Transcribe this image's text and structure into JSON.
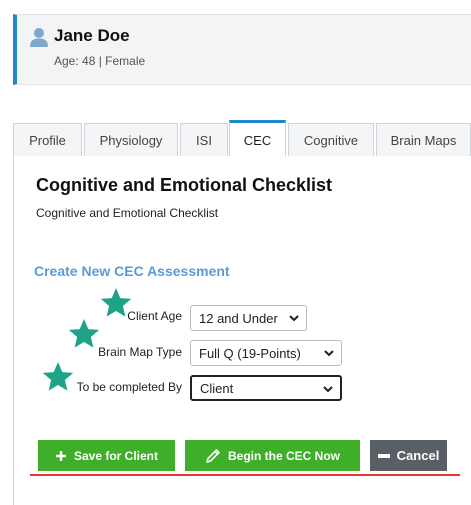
{
  "patient": {
    "name": "Jane Doe",
    "meta": "Age: 48 | Female"
  },
  "tabs": [
    {
      "label": "Profile"
    },
    {
      "label": "Physiology"
    },
    {
      "label": "ISI"
    },
    {
      "label": "CEC",
      "active": true
    },
    {
      "label": "Cognitive"
    },
    {
      "label": "Brain Maps"
    }
  ],
  "page": {
    "title": "Cognitive and Emotional Checklist",
    "subtitle": "Cognitive and Emotional Checklist",
    "section_title": "Create New CEC Assessment"
  },
  "form": {
    "client_age": {
      "label": "Client Age",
      "value": "12 and Under"
    },
    "brain_map_type": {
      "label": "Brain Map Type",
      "value": "Full Q (19-Points)"
    },
    "completed_by": {
      "label": "To be completed By",
      "value": "Client"
    }
  },
  "buttons": {
    "save_for_client": "Save for Client",
    "begin_cec": "Begin the CEC Now",
    "cancel": "Cancel"
  },
  "colors": {
    "accent": "#1e88c8",
    "section_title": "#5b9bd5",
    "green_button": "#3fae29",
    "cancel_button": "#5a5f66",
    "star": "#1fa386",
    "red_rule": "#e53935"
  },
  "icons": {
    "patient": "user-icon",
    "save": "plus-icon",
    "begin": "pencil-icon",
    "cancel": "minus-icon",
    "marker": "star-icon"
  }
}
